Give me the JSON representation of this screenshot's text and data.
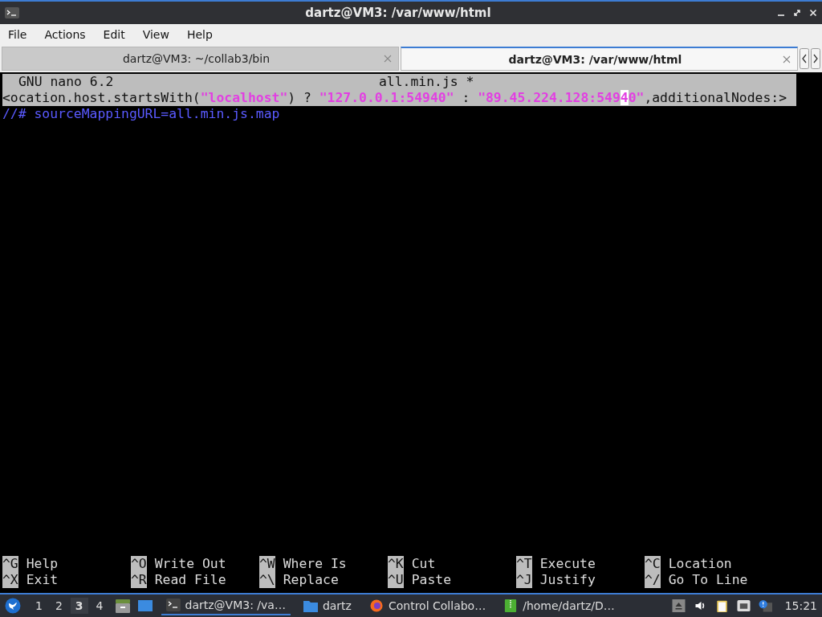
{
  "window": {
    "title": "dartz@VM3: /var/www/html"
  },
  "menu": [
    "File",
    "Actions",
    "Edit",
    "View",
    "Help"
  ],
  "tabs": [
    {
      "label": "dartz@VM3: ~/collab3/bin",
      "selected": false
    },
    {
      "label": "dartz@VM3: /var/www/html",
      "selected": true
    }
  ],
  "nano": {
    "version": "GNU nano 6.2",
    "filename": "all.min.js *",
    "lines": [
      {
        "selected": true,
        "segments": [
          {
            "text": "<ocation.host.startsWith(",
            "kind": "plain"
          },
          {
            "text": "\"localhost\"",
            "kind": "string"
          },
          {
            "text": ") ? ",
            "kind": "plain"
          },
          {
            "text": "\"127.0.0.1:54940\"",
            "kind": "string"
          },
          {
            "text": " : ",
            "kind": "plain"
          },
          {
            "text": "\"89.45.224.128:549",
            "kind": "string"
          },
          {
            "text": "4",
            "kind": "cursor"
          },
          {
            "text": "0\"",
            "kind": "string"
          },
          {
            "text": ",additionalNodes:>",
            "kind": "plain"
          }
        ]
      },
      {
        "selected": false,
        "segments": [
          {
            "text": "//# sourceMappingURL=all.min.js.map",
            "kind": "comment"
          }
        ]
      }
    ],
    "shortcuts": [
      {
        "key": "^G",
        "label": "Help"
      },
      {
        "key": "^O",
        "label": "Write Out"
      },
      {
        "key": "^W",
        "label": "Where Is"
      },
      {
        "key": "^K",
        "label": "Cut"
      },
      {
        "key": "^T",
        "label": "Execute"
      },
      {
        "key": "^C",
        "label": "Location"
      },
      {
        "key": "^X",
        "label": "Exit"
      },
      {
        "key": "^R",
        "label": "Read File"
      },
      {
        "key": "^\\",
        "label": "Replace"
      },
      {
        "key": "^U",
        "label": "Paste"
      },
      {
        "key": "^J",
        "label": "Justify"
      },
      {
        "key": "^/",
        "label": "Go To Line"
      }
    ]
  },
  "taskbar": {
    "workspaces": [
      {
        "label": "1",
        "selected": false
      },
      {
        "label": "2",
        "selected": false
      },
      {
        "label": "3",
        "selected": true
      },
      {
        "label": "4",
        "selected": false
      }
    ],
    "tasks": [
      {
        "label": "dartz@VM3: /va…",
        "kind": "terminal",
        "selected": true
      },
      {
        "label": "dartz",
        "kind": "folder",
        "selected": false
      },
      {
        "label": "Control Collabo…",
        "kind": "browser",
        "selected": false
      },
      {
        "label": "/home/dartz/D…",
        "kind": "archive",
        "selected": false
      }
    ],
    "clock": "15:21"
  }
}
